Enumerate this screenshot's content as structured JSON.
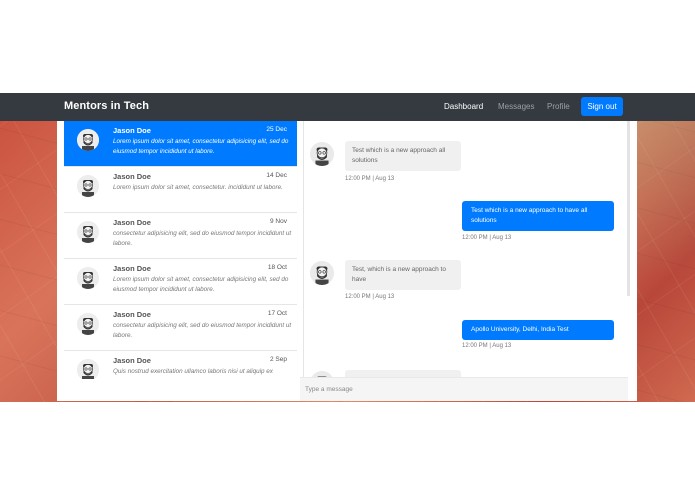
{
  "navbar": {
    "brand": "Mentors in Tech",
    "links": [
      "Dashboard",
      "Messages",
      "Profile"
    ],
    "signout_label": "Sign out",
    "accent_color": "#007bff",
    "background_color": "#343a40"
  },
  "conversations": [
    {
      "name": "Jason Doe",
      "date": "25 Dec",
      "preview": "Lorem ipsum dolor sit amet, consectetur adipisicing elit, sed do eiusmod tempor incididunt ut labore.",
      "active": true,
      "icon": "bearded-man-avatar-icon"
    },
    {
      "name": "Jason Doe",
      "date": "14 Dec",
      "preview": "Lorem ipsum dolor sit amet, consectetur. incididunt ut labore.",
      "active": false,
      "icon": "bearded-man-avatar-icon"
    },
    {
      "name": "Jason Doe",
      "date": "9 Nov",
      "preview": "consectetur adipisicing elit, sed do eiusmod tempor incididunt ut labore.",
      "active": false,
      "icon": "bearded-man-avatar-icon"
    },
    {
      "name": "Jason Doe",
      "date": "18 Oct",
      "preview": "Lorem ipsum dolor sit amet, consectetur adipisicing elit, sed do eiusmod tempor incididunt ut labore.",
      "active": false,
      "icon": "bearded-man-avatar-icon"
    },
    {
      "name": "Jason Doe",
      "date": "17 Oct",
      "preview": "consectetur adipisicing elit, sed do eiusmod tempor incididunt ut labore.",
      "active": false,
      "icon": "bearded-man-avatar-icon"
    },
    {
      "name": "Jason Doe",
      "date": "2 Sep",
      "preview": "Quis nostrud exercitation ullamco laboris nisi ut aliquip ex",
      "active": false,
      "icon": "bearded-man-avatar-icon"
    }
  ],
  "messages": [
    {
      "direction": "incoming",
      "text": "Test which is a new approach all solutions",
      "time": "12:00 PM | Aug 13"
    },
    {
      "direction": "outgoing",
      "text": "Test which is a new approach to have all solutions",
      "time": "12:00 PM | Aug 13"
    },
    {
      "direction": "incoming",
      "text": "Test, which is a new approach to have",
      "time": "12:00 PM | Aug 13"
    },
    {
      "direction": "outgoing",
      "text": "Apollo University, Delhi, India Test",
      "time": "12:00 PM | Aug 13"
    }
  ],
  "compose": {
    "placeholder": "Type a message"
  }
}
